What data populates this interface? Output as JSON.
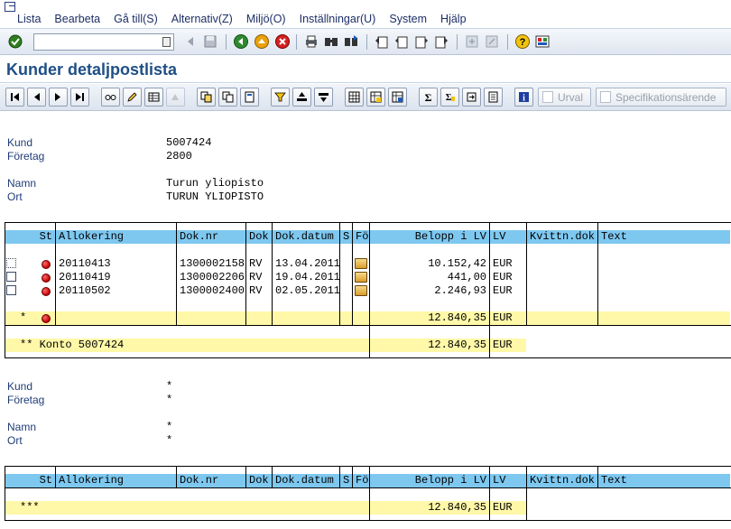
{
  "menu": {
    "items": [
      "Lista",
      "Bearbeta",
      "Gå till(S)",
      "Alternativ(Z)",
      "Miljö(O)",
      "Inställningar(U)",
      "System",
      "Hjälp"
    ]
  },
  "stdbar": {
    "command_value": "",
    "icons": [
      "enter-icon",
      "command-dropdown-icon",
      "back-arrow-icon",
      "save-icon",
      "back-icon",
      "exit-icon",
      "cancel-icon",
      "print-icon",
      "find-icon",
      "find-next-icon",
      "first-page-icon",
      "previous-page-icon",
      "next-page-icon",
      "last-page-icon",
      "new-session-icon",
      "shortcut-icon",
      "help-icon",
      "layout-icon"
    ]
  },
  "title": "Kunder detaljpostlista",
  "appbar": {
    "urval_label": "Urval",
    "spec_label": "Specifikationsärende"
  },
  "customer1": {
    "kund_label": "Kund",
    "kund_value": "5007424",
    "foretag_label": "Företag",
    "foretag_value": "2800",
    "namn_label": "Namn",
    "namn_value": "Turun yliopisto",
    "ort_label": "Ort",
    "ort_value": "TURUN YLIOPISTO"
  },
  "table_headers": [
    "St",
    "Allokering",
    "Dok.nr",
    "Dok",
    "Dok.datum",
    "S",
    "Fö",
    "Belopp i LV",
    "LV",
    "Kvittn.dok",
    "Text"
  ],
  "rows": [
    {
      "allokering": "20110413",
      "doknr": "1300002158",
      "dok": "RV",
      "datum": "13.04.2011",
      "belopp": "10.152,42",
      "lv": "EUR"
    },
    {
      "allokering": "20110419",
      "doknr": "1300002206",
      "dok": "RV",
      "datum": "19.04.2011",
      "belopp": "441,00",
      "lv": "EUR"
    },
    {
      "allokering": "20110502",
      "doknr": "1300002400",
      "dok": "RV",
      "datum": "02.05.2011",
      "belopp": "2.246,93",
      "lv": "EUR"
    }
  ],
  "subtotal": {
    "marker": "*",
    "belopp": "12.840,35",
    "lv": "EUR"
  },
  "konto": {
    "label": "** Konto 5007424",
    "belopp": "12.840,35",
    "lv": "EUR"
  },
  "customer2": {
    "kund_label": "Kund",
    "kund_value": "*",
    "foretag_label": "Företag",
    "foretag_value": "*",
    "namn_label": "Namn",
    "namn_value": "*",
    "ort_label": "Ort",
    "ort_value": "*"
  },
  "grand_total": {
    "marker": "***",
    "belopp": "12.840,35",
    "lv": "EUR"
  },
  "colors": {
    "header_blue": "#7ec8f0",
    "total_yellow": "#fff8a8",
    "title_blue": "#1e4f86",
    "status_red": "#c00000"
  }
}
